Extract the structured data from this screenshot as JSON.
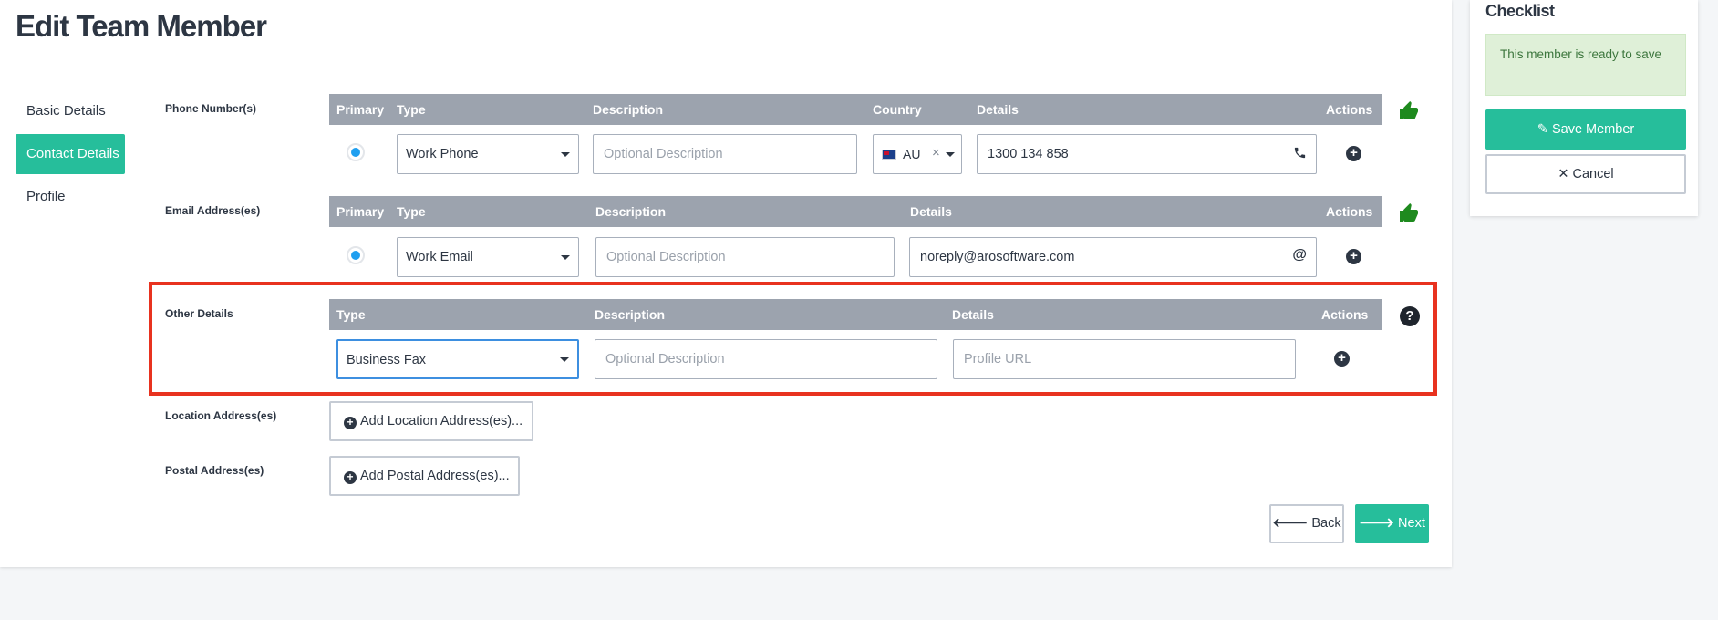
{
  "page": {
    "title": "Edit Team Member"
  },
  "sidenav": {
    "items": [
      {
        "label": "Basic Details",
        "active": false
      },
      {
        "label": "Contact Details",
        "active": true
      },
      {
        "label": "Profile",
        "active": false
      }
    ]
  },
  "phone": {
    "label": "Phone Number(s)",
    "headers": {
      "primary": "Primary",
      "type": "Type",
      "description": "Description",
      "country": "Country",
      "details": "Details",
      "actions": "Actions"
    },
    "row": {
      "type": "Work Phone",
      "description_placeholder": "Optional Description",
      "country_code": "AU",
      "details": "1300 134 858",
      "details_icon": "phone-icon"
    }
  },
  "email": {
    "label": "Email Address(es)",
    "headers": {
      "primary": "Primary",
      "type": "Type",
      "description": "Description",
      "details": "Details",
      "actions": "Actions"
    },
    "row": {
      "type": "Work Email",
      "description_placeholder": "Optional Description",
      "details": "noreply@arosoftware.com",
      "details_icon": "at-icon"
    }
  },
  "other": {
    "label": "Other Details",
    "headers": {
      "type": "Type",
      "description": "Description",
      "details": "Details",
      "actions": "Actions"
    },
    "row": {
      "type": "Business Fax",
      "description_placeholder": "Optional Description",
      "details_placeholder": "Profile URL"
    }
  },
  "location": {
    "label": "Location Address(es)",
    "button": "Add Location Address(es)..."
  },
  "postal": {
    "label": "Postal Address(es)",
    "button": "Add Postal Address(es)..."
  },
  "footer": {
    "back": "Back",
    "next": "Next"
  },
  "checklist": {
    "title": "Checklist",
    "status": "This member is ready to save",
    "save": "Save Member",
    "cancel": "Cancel"
  },
  "colors": {
    "accent": "#26be9b",
    "table_header": "#9ca3ae",
    "highlight": "#e8321f",
    "thumbs_up": "#1e8a1e",
    "radio": "#1f9ff0",
    "success_bg": "#dff0d8"
  }
}
